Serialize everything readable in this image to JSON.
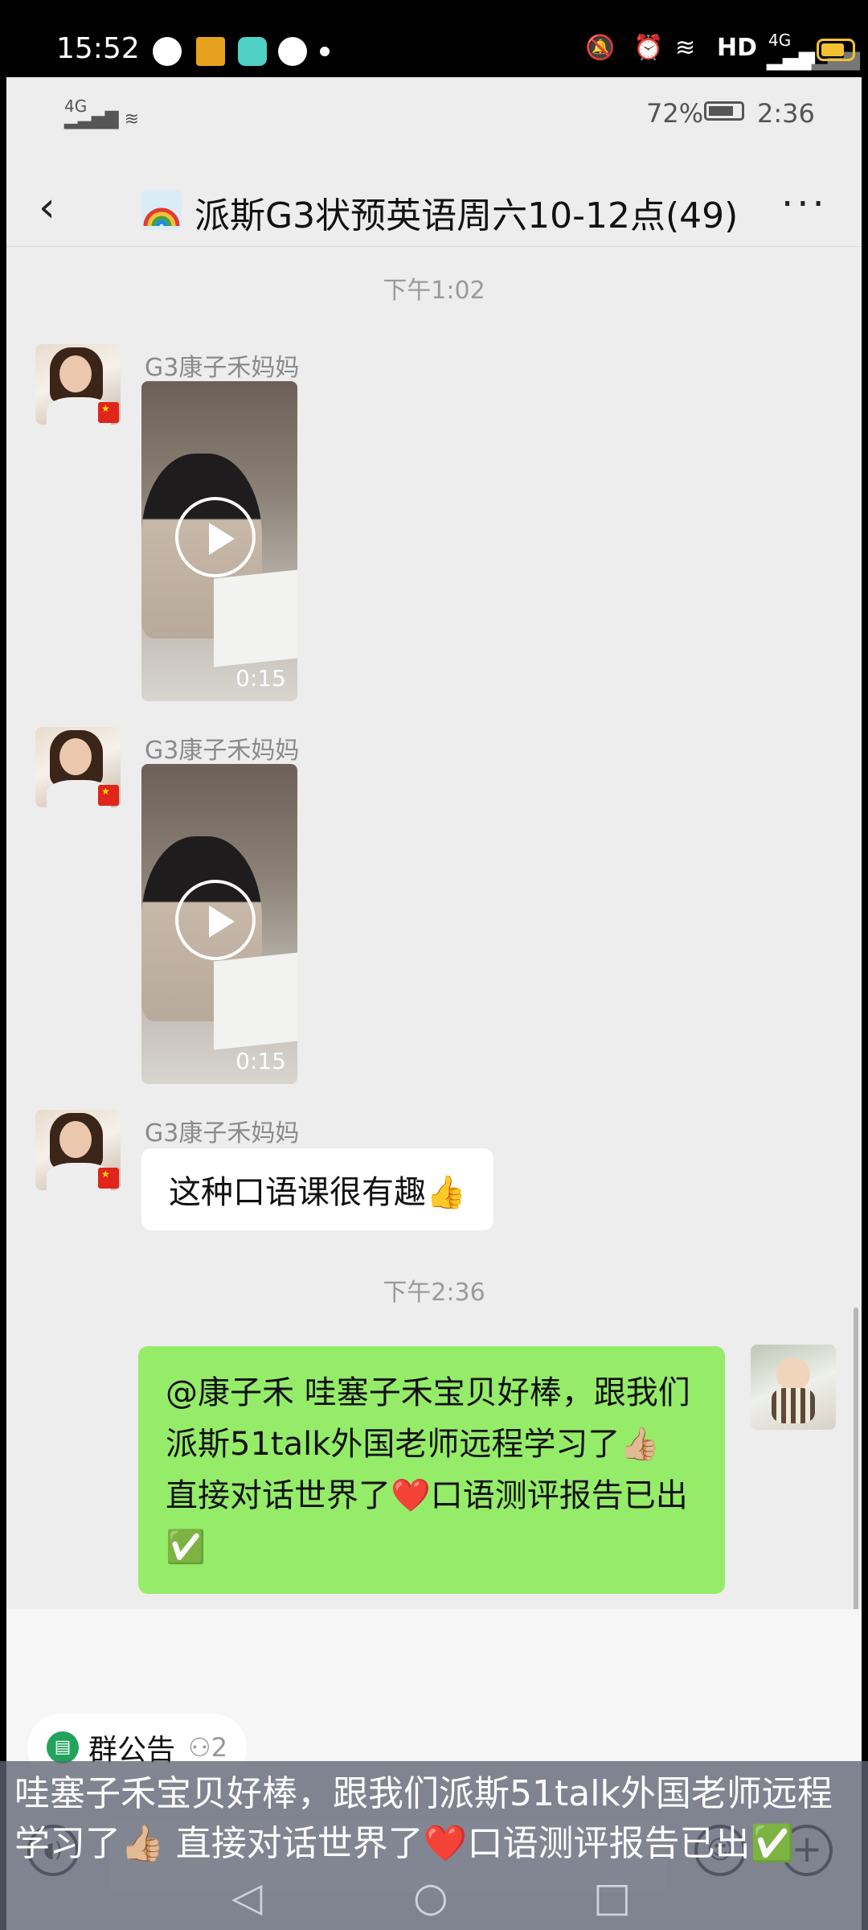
{
  "outer_status": {
    "time": "15:52",
    "network_label": "HD",
    "signal_label": "4G"
  },
  "inner_status": {
    "signal_label": "4G",
    "battery": "72%",
    "time": "2:36"
  },
  "nav": {
    "back_icon": "‹",
    "title": "派斯G3状预英语周六10-12点(49)",
    "more_icon": "···"
  },
  "messages": {
    "ts1": "下午1:02",
    "m1": {
      "sender": "G3康子禾妈妈",
      "duration": "0:15"
    },
    "m2": {
      "sender": "G3康子禾妈妈",
      "duration": "0:15"
    },
    "m3": {
      "sender": "G3康子禾妈妈",
      "text": "这种口语课很有趣👍"
    },
    "ts2": "下午2:36",
    "m4": {
      "text": "@康子禾 哇塞子禾宝贝好棒，跟我们派斯51talk外国老师远程学习了👍🏼 直接对话世界了❤️口语测评报告已出✅"
    }
  },
  "bottom": {
    "notice_label": "群公告",
    "notice_count": "2"
  },
  "caption": {
    "text": "哇塞子禾宝贝好棒，跟我们派斯51talk外国老师远程学习了👍🏼 直接对话世界了❤️口语测评报告已出✅"
  },
  "colors": {
    "outgoing_bubble": "#95ec69",
    "background": "#ededed",
    "notice_icon": "#21a35b"
  }
}
